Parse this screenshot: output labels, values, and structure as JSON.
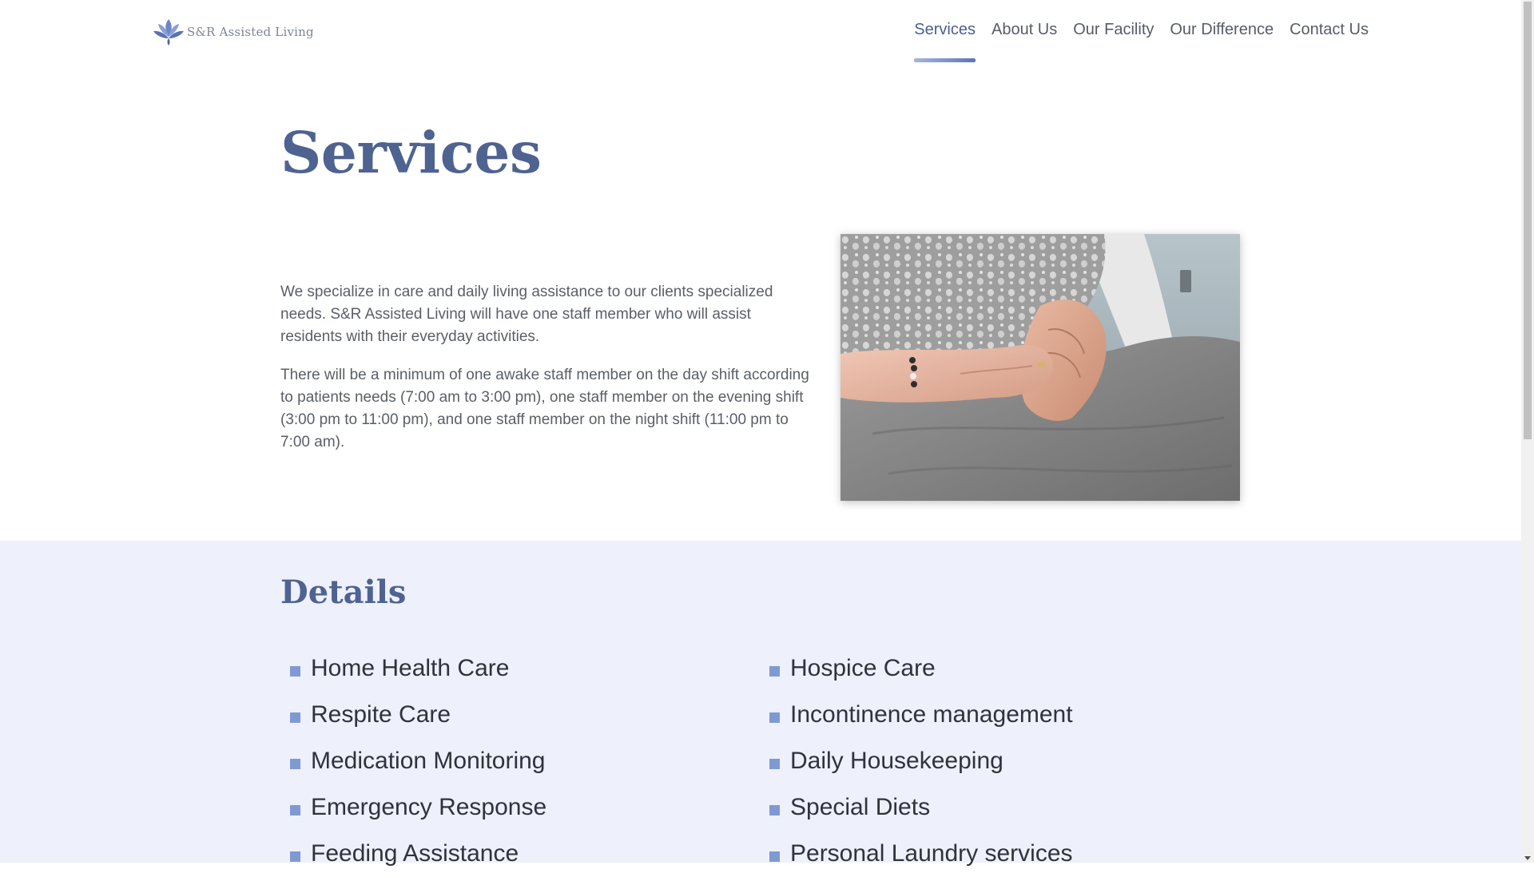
{
  "header": {
    "logo_text": "S&R Assisted Living",
    "logo_icon": "lotus-icon",
    "nav": [
      {
        "label": "Services",
        "active": true
      },
      {
        "label": "About Us",
        "active": false
      },
      {
        "label": "Our Facility",
        "active": false
      },
      {
        "label": "Our Difference",
        "active": false
      },
      {
        "label": "Contact Us",
        "active": false
      }
    ]
  },
  "intro": {
    "title": "Services",
    "paragraphs": [
      "We specialize in care and daily living assistance to our clients specialized needs. S&R Assisted Living will have one staff member who will assist residents with their everyday activities.",
      "There will be a minimum of one awake staff member on the day shift according to patients needs (7:00 am to 3:00 pm), one staff member on the evening shift (3:00 pm to 11:00 pm), and one staff member on the night shift (11:00 pm to 7:00 am)."
    ]
  },
  "details": {
    "title": "Details",
    "column1": [
      "Home Health Care",
      "Respite Care",
      "Medication Monitoring",
      "Emergency Response",
      "Feeding Assistance"
    ],
    "column2": [
      "Hospice Care",
      "Incontinence management",
      "Daily Housekeeping",
      "Special Diets",
      "Personal Laundry services"
    ]
  },
  "colors": {
    "accent": "#4f6391",
    "bullet": "#7f9ad3",
    "details_background": "#eef0fc"
  }
}
